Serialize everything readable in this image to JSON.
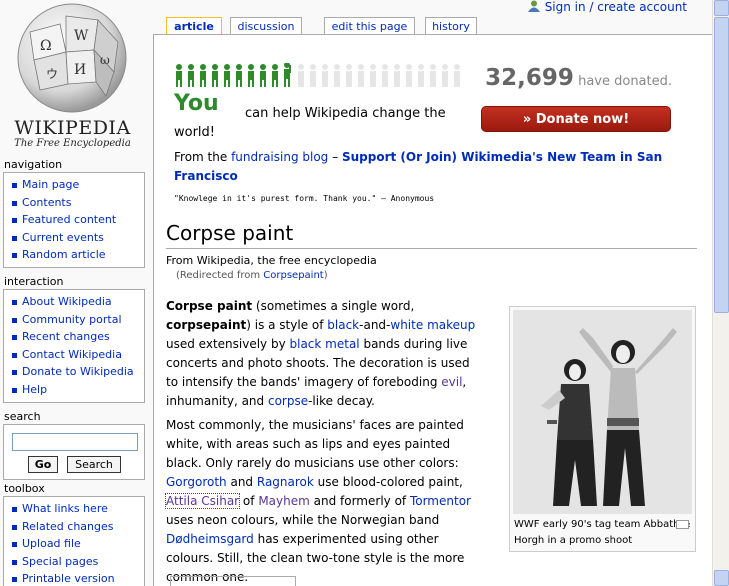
{
  "logo": {
    "wordmark": "WIKIPEDIA",
    "tagline": "The Free Encyclopedia"
  },
  "personal": {
    "login_label": "Sign in / create account"
  },
  "tabs": [
    {
      "label": "article",
      "selected": true
    },
    {
      "label": "discussion",
      "selected": false
    },
    {
      "label": "edit this page",
      "selected": false
    },
    {
      "label": "history",
      "selected": false
    }
  ],
  "banner": {
    "you": "You",
    "help_text": "can help Wikipedia change the world!",
    "donated_count": "32,699",
    "donated_suffix": "have donated.",
    "donate_button": "» Donate now!",
    "blog_prefix": "From the",
    "blog_link": "fundraising blog",
    "blog_dash": "–",
    "blog_headline": "Support (Or Join) Wikimedia's New Team in San Francisco",
    "quote": "\"Knowlege in it's purest form. Thank you.\" — Anonymous"
  },
  "article": {
    "title": "Corpse paint",
    "from": "From Wikipedia, the free encyclopedia",
    "redirected_prefix": "(Redirected from",
    "redirected_link": "Corpsepaint",
    "redirected_suffix": ")",
    "p1": {
      "t1": "Corpse paint",
      "t2": " (sometimes a single word, ",
      "t3": "corpsepaint",
      "t4": ") is a style of ",
      "l1": "black",
      "t5": "-and-",
      "l2": "white",
      "t6": " ",
      "l3": "makeup",
      "t7": " used extensively by ",
      "l4": "black metal",
      "t8": " bands during live concerts and photo shoots. The decoration is used to intensify the bands' imagery of foreboding ",
      "l5": "evil",
      "t9": ", inhumanity, and ",
      "l6": "corpse",
      "t10": "-like decay."
    },
    "p2": {
      "t1": "Most commonly, the musicians' faces are painted white, with areas such as lips and eyes painted black. Only rarely do musicians use other colors: ",
      "l1": "Gorgoroth",
      "t2": " and ",
      "l2": "Ragnarok",
      "t3": " use blood-colored paint, ",
      "l3": "Attila Csihar",
      "t4": " of ",
      "l4": "Mayhem",
      "t5": " and formerly of ",
      "l5": "Tormentor",
      "t6": " uses neon colours, while the Norwegian band ",
      "l6": "Dødheimsgard",
      "t7": " has experimented using other colours. Still, the clean two-tone style is the more common one."
    },
    "thumb_caption": "WWF early 90's tag team Abbath & Horgh in a promo shoot"
  },
  "sidebar": {
    "navigation": {
      "title": "navigation",
      "items": [
        {
          "label": "Main page"
        },
        {
          "label": "Contents"
        },
        {
          "label": "Featured content"
        },
        {
          "label": "Current events"
        },
        {
          "label": "Random article"
        }
      ]
    },
    "interaction": {
      "title": "interaction",
      "items": [
        {
          "label": "About Wikipedia"
        },
        {
          "label": "Community portal"
        },
        {
          "label": "Recent changes"
        },
        {
          "label": "Contact Wikipedia"
        },
        {
          "label": "Donate to Wikipedia"
        },
        {
          "label": "Help"
        }
      ]
    },
    "search": {
      "title": "search",
      "go_label": "Go",
      "search_label": "Search"
    },
    "toolbox": {
      "title": "toolbox",
      "items": [
        {
          "label": "What links here"
        },
        {
          "label": "Related changes"
        },
        {
          "label": "Upload file"
        },
        {
          "label": "Special pages"
        },
        {
          "label": "Printable version"
        }
      ]
    }
  }
}
